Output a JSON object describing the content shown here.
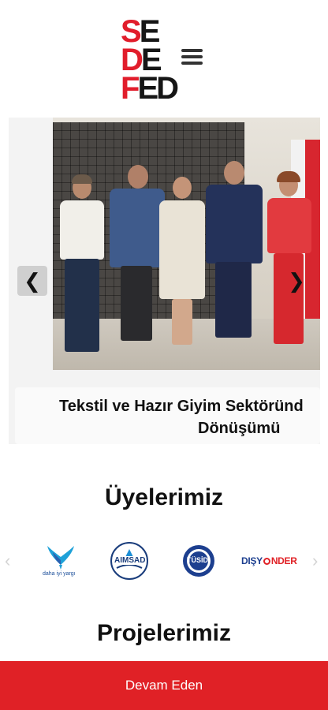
{
  "header": {
    "logo_letters": [
      "S",
      "E",
      "D",
      "E",
      "F",
      "ED"
    ],
    "menu_icon": "hamburger-menu-icon"
  },
  "slider": {
    "caption_line1": "Tekstil ve Hazır Giyim Sektöründ",
    "caption_line2": "Dönüşümü",
    "prev_glyph": "❮",
    "next_glyph": "❯"
  },
  "members": {
    "title": "Üyelerimiz",
    "prev_glyph": "‹",
    "next_glyph": "›",
    "logos": [
      {
        "name": "daha iyi yargı",
        "text": "daha iyi yargı"
      },
      {
        "name": "AIMSAD",
        "text": "AIMSAD"
      },
      {
        "name": "TÜSİD",
        "text": "TÜSİD"
      },
      {
        "name": "DIŞYÖNDER",
        "text_a": "DIŞY",
        "text_b": "NDER"
      }
    ]
  },
  "projects": {
    "title": "Projelerimiz"
  },
  "bottom_button": {
    "label": "Devam Eden"
  },
  "colors": {
    "brand_red": "#e11d2b",
    "button_red": "#e02126",
    "dark": "#161616"
  }
}
